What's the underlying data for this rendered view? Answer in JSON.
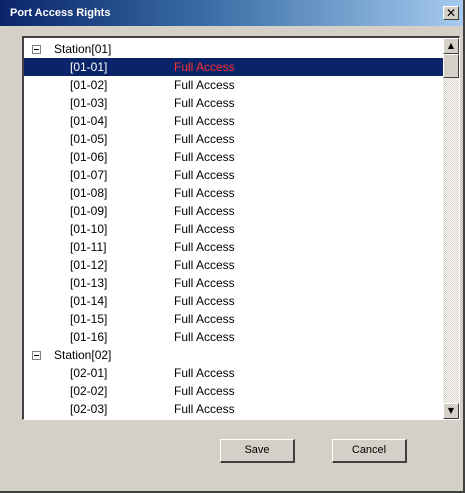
{
  "window": {
    "title": "Port Access Rights",
    "close_glyph": "✕"
  },
  "tree": {
    "stations": [
      {
        "label": "Station[01]",
        "expanded": true,
        "ports": [
          {
            "port": "[01-01]",
            "access": "Full Access",
            "selected": true
          },
          {
            "port": "[01-02]",
            "access": "Full Access"
          },
          {
            "port": "[01-03]",
            "access": "Full Access"
          },
          {
            "port": "[01-04]",
            "access": "Full Access"
          },
          {
            "port": "[01-05]",
            "access": "Full Access"
          },
          {
            "port": "[01-06]",
            "access": "Full Access"
          },
          {
            "port": "[01-07]",
            "access": "Full Access"
          },
          {
            "port": "[01-08]",
            "access": "Full Access"
          },
          {
            "port": "[01-09]",
            "access": "Full Access"
          },
          {
            "port": "[01-10]",
            "access": "Full Access"
          },
          {
            "port": "[01-11]",
            "access": "Full Access"
          },
          {
            "port": "[01-12]",
            "access": "Full Access"
          },
          {
            "port": "[01-13]",
            "access": "Full Access"
          },
          {
            "port": "[01-14]",
            "access": "Full Access"
          },
          {
            "port": "[01-15]",
            "access": "Full Access"
          },
          {
            "port": "[01-16]",
            "access": "Full Access"
          }
        ]
      },
      {
        "label": "Station[02]",
        "expanded": true,
        "ports": [
          {
            "port": "[02-01]",
            "access": "Full Access"
          },
          {
            "port": "[02-02]",
            "access": "Full Access"
          },
          {
            "port": "[02-03]",
            "access": "Full Access"
          }
        ]
      }
    ]
  },
  "scrollbar": {
    "up_glyph": "▲",
    "down_glyph": "▼"
  },
  "buttons": {
    "save_label": "Save",
    "cancel_label": "Cancel"
  },
  "colors": {
    "selection_bg": "#0a246a",
    "selected_access_text": "#ff3030"
  }
}
